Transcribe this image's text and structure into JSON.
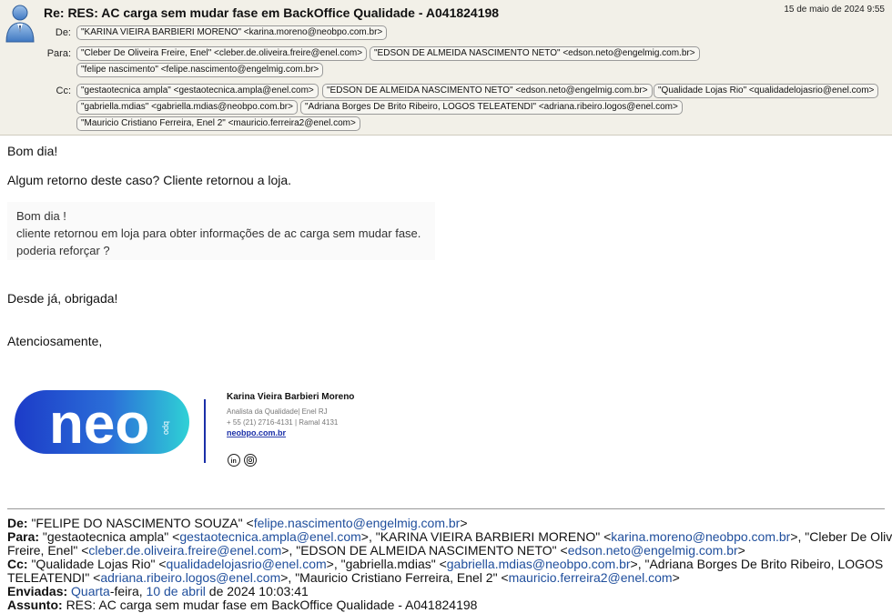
{
  "header": {
    "subject": "Re: RES: AC carga sem mudar fase em BackOffice Qualidade - A041824198",
    "date": "15 de maio de 2024 9:55",
    "from_label": "De:",
    "to_label": "Para:",
    "cc_label": "Cc:",
    "from": "\"KARINA VIEIRA BARBIERI MORENO\" <karina.moreno@neobpo.com.br>",
    "to": [
      "\"Cleber De Oliveira Freire, Enel\" <cleber.de.oliveira.freire@enel.com>",
      "\"EDSON DE ALMEIDA NASCIMENTO NETO\" <edson.neto@engelmig.com.br>",
      "\"felipe nascimento\" <felipe.nascimento@engelmig.com.br>"
    ],
    "cc": [
      "\"gestaotecnica ampla\" <gestaotecnica.ampla@enel.com>",
      "\"EDSON DE ALMEIDA NASCIMENTO NETO\" <edson.neto@engelmig.com.br>",
      "\"Qualidade Lojas Rio\" <qualidadelojasrio@enel.com>",
      "\"gabriella.mdias\" <gabriella.mdias@neobpo.com.br>",
      "\"Adriana Borges De Brito Ribeiro, LOGOS TELEATENDI\" <adriana.ribeiro.logos@enel.com>",
      "\"Mauricio Cristiano Ferreira, Enel 2\" <mauricio.ferreira2@enel.com>"
    ]
  },
  "body": {
    "greeting": "Bom dia!",
    "line1": "Algum retorno deste caso? Cliente retornou a loja.",
    "quote": [
      "Bom dia !",
      "cliente retornou em loja para obter informações de ac carga sem mudar fase.",
      "poderia reforçar ?"
    ],
    "thanks": "Desde já, obrigada!",
    "closing": "Atenciosamente,"
  },
  "signature": {
    "logo_text": "neo",
    "logo_sub": "bpo",
    "name": "Karina Vieira Barbieri Moreno",
    "role": "Analista da Qualidade| Enel RJ",
    "phone": "+ 55 (21) 2716-4131  |  Ramal 4131",
    "site": "neobpo.com.br",
    "icons": [
      "linkedin-icon",
      "instagram-icon"
    ],
    "logo_gradient": [
      "#1c3bc8",
      "#2fd1d6"
    ],
    "divider_color": "#1a2fa8"
  },
  "forwarded": {
    "from_label": "De:",
    "from_name": "\"FELIPE DO NASCIMENTO SOUZA\" <",
    "from_email": "felipe.nascimento@engelmig.com.br",
    "from_end": ">",
    "to_label": "Para:",
    "to_1": "\"gestaotecnica ampla\" <",
    "to_1_email": "gestaotecnica.ampla@enel.com",
    "to_2": ">, \"KARINA VIEIRA BARBIERI MORENO\" <",
    "to_2_email": "karina.moreno@neobpo.com.br",
    "to_3": ">, \"Cleber De Oliveira",
    "to_4": "Freire, Enel\" <",
    "to_4_email": "cleber.de.oliveira.freire@enel.com",
    "to_5": ">, \"EDSON DE ALMEIDA NASCIMENTO NETO\" <",
    "to_5_email": "edson.neto@engelmig.com.br",
    "to_6": ">",
    "cc_label": "Cc:",
    "cc_1": "\"Qualidade Lojas Rio\" <",
    "cc_1_email": "qualidadelojasrio@enel.com",
    "cc_2": ">, \"gabriella.mdias\" <",
    "cc_2_email": "gabriella.mdias@neobpo.com.br",
    "cc_3": ">, \"Adriana Borges De Brito Ribeiro, LOGOS",
    "cc_4": "TELEATENDI\" <",
    "cc_4_email": "adriana.ribeiro.logos@enel.com",
    "cc_5": ">, \"Mauricio Cristiano Ferreira, Enel 2\" <",
    "cc_5_email": "mauricio.ferreira2@enel.com",
    "cc_6": ">",
    "sent_label": "Enviadas:",
    "sent_day": "Quarta",
    "sent_mid": "-feira, ",
    "sent_date": "10 de abril",
    "sent_rest": " de 2024 10:03:41",
    "subject_label": "Assunto:",
    "subject": "RES: AC carga sem mudar fase em BackOffice Qualidade - A041824198"
  }
}
